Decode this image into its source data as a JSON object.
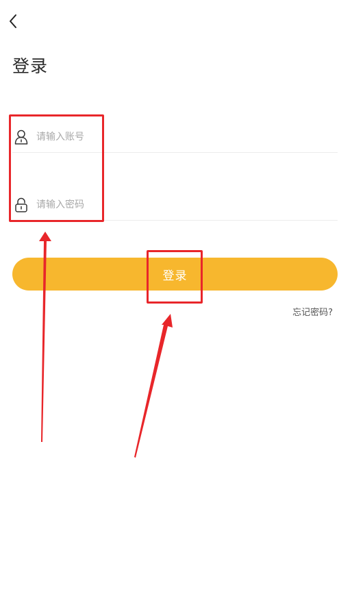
{
  "header": {
    "back_icon": "chevron-left-icon",
    "title": "登录"
  },
  "form": {
    "account": {
      "icon": "user-icon",
      "placeholder": "请输入账号",
      "value": ""
    },
    "password": {
      "icon": "lock-icon",
      "placeholder": "请输入密码",
      "value": ""
    }
  },
  "login_button": {
    "label": "登录",
    "color": "#f7b72e"
  },
  "forgot_password": {
    "label": "忘记密码?"
  },
  "annotations": {
    "color": "#e8262a"
  }
}
